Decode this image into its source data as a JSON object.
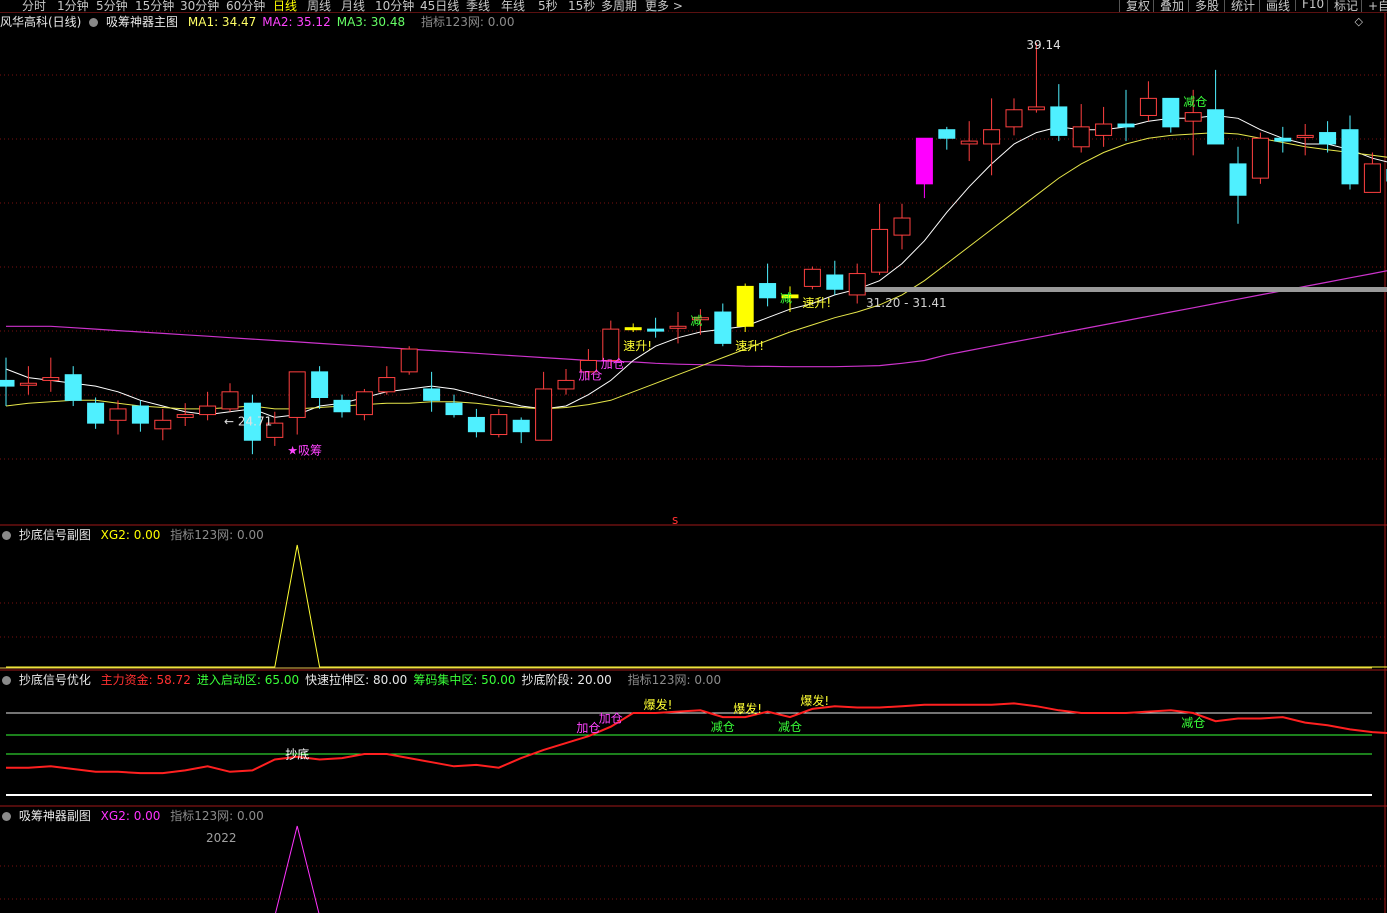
{
  "toolbar": {
    "periods": [
      "分时",
      "1分钟",
      "5分钟",
      "15分钟",
      "30分钟",
      "60分钟",
      "日线",
      "周线",
      "月线",
      "10分钟",
      "45日线",
      "季线",
      "年线",
      "5秒",
      "15秒",
      "多周期",
      "更多 >"
    ],
    "active_period": "日线",
    "tools": [
      "复权",
      "叠加",
      "多股",
      "统计",
      "画线",
      "F10",
      "标记",
      "+自"
    ]
  },
  "main_panel": {
    "title": "风华高科(日线)",
    "indicator": "吸筹神器主图",
    "ma": [
      {
        "label": "MA1:",
        "value": "34.47",
        "color": "#ffff66"
      },
      {
        "label": "MA2:",
        "value": "35.12",
        "color": "#ff44ff"
      },
      {
        "label": "MA3:",
        "value": "30.48",
        "color": "#66ff66"
      }
    ],
    "source": "指标123网: 0.00",
    "expand_icon": "diamond-icon"
  },
  "sub_panel_1": {
    "name": "抄底信号副图",
    "series": "XG2:",
    "value": "0.00",
    "source": "指标123网: 0.00"
  },
  "sub_panel_2": {
    "name": "抄底信号优化",
    "items": [
      {
        "label": "主力资金:",
        "value": "58.72",
        "color": "#ff3030"
      },
      {
        "label": "进入启动区:",
        "value": "65.00",
        "color": "#39ff39"
      },
      {
        "label": "快速拉伸区:",
        "value": "80.00",
        "color": "#e8e8e8"
      },
      {
        "label": "筹码集中区:",
        "value": "50.00",
        "color": "#39ff39"
      },
      {
        "label": "抄底阶段:",
        "value": "20.00",
        "color": "#e8e8e8"
      }
    ],
    "source": "指标123网: 0.00"
  },
  "sub_panel_3": {
    "name": "吸筹神器副图",
    "series": "XG2:",
    "value": "0.00",
    "source": "指标123网: 0.00",
    "year_label": "2022"
  },
  "chart_data": {
    "type": "candlestick",
    "main": {
      "candles": [
        {
          "o": 27.3,
          "c": 27.1,
          "h": 28.1,
          "l": 26.4
        },
        {
          "o": 27.2,
          "c": 27.2,
          "h": 27.8,
          "l": 26.8
        },
        {
          "o": 27.3,
          "c": 27.4,
          "h": 28.1,
          "l": 26.9
        },
        {
          "o": 27.5,
          "c": 26.6,
          "h": 27.8,
          "l": 26.4
        },
        {
          "o": 26.5,
          "c": 25.8,
          "h": 26.7,
          "l": 25.6
        },
        {
          "o": 25.9,
          "c": 26.3,
          "h": 26.6,
          "l": 25.4
        },
        {
          "o": 26.4,
          "c": 25.8,
          "h": 26.6,
          "l": 25.5
        },
        {
          "o": 25.6,
          "c": 25.9,
          "h": 26.3,
          "l": 25.2
        },
        {
          "o": 26.0,
          "c": 26.1,
          "h": 26.5,
          "l": 25.7
        },
        {
          "o": 26.1,
          "c": 26.4,
          "h": 26.9,
          "l": 25.9
        },
        {
          "o": 26.3,
          "c": 26.9,
          "h": 27.2,
          "l": 26.2
        },
        {
          "o": 26.5,
          "c": 25.2,
          "h": 26.8,
          "l": 24.71
        },
        {
          "o": 25.3,
          "c": 25.8,
          "h": 26.2,
          "l": 25.0
        },
        {
          "o": 26.0,
          "c": 27.6,
          "h": 27.6,
          "l": 25.4
        },
        {
          "o": 27.6,
          "c": 26.7,
          "h": 27.8,
          "l": 26.3
        },
        {
          "o": 26.6,
          "c": 26.2,
          "h": 26.8,
          "l": 26.0
        },
        {
          "o": 26.1,
          "c": 26.9,
          "h": 27.0,
          "l": 25.9
        },
        {
          "o": 26.9,
          "c": 27.4,
          "h": 27.8,
          "l": 26.8
        },
        {
          "o": 27.6,
          "c": 28.4,
          "h": 28.5,
          "l": 27.5
        },
        {
          "o": 27.0,
          "c": 26.6,
          "h": 27.6,
          "l": 26.2
        },
        {
          "o": 26.5,
          "c": 26.1,
          "h": 26.8,
          "l": 26.0
        },
        {
          "o": 26.0,
          "c": 25.5,
          "h": 26.3,
          "l": 25.3
        },
        {
          "o": 25.4,
          "c": 26.1,
          "h": 26.3,
          "l": 25.3
        },
        {
          "o": 25.9,
          "c": 25.5,
          "h": 26.0,
          "l": 25.1
        },
        {
          "o": 25.2,
          "c": 27.0,
          "h": 27.6,
          "l": 25.2
        },
        {
          "o": 27.0,
          "c": 27.3,
          "h": 27.7,
          "l": 26.8
        },
        {
          "o": 27.6,
          "c": 28.0,
          "h": 28.4,
          "l": 27.4
        },
        {
          "o": 28.0,
          "c": 29.1,
          "h": 29.4,
          "l": 27.8
        },
        {
          "o": 29.15,
          "c": 29.15,
          "h": 29.3,
          "l": 29.0
        },
        {
          "o": 29.1,
          "c": 29.05,
          "h": 29.5,
          "l": 28.8
        },
        {
          "o": 29.2,
          "c": 29.2,
          "h": 29.7,
          "l": 28.6
        },
        {
          "o": 29.5,
          "c": 29.5,
          "h": 29.8,
          "l": 28.9
        },
        {
          "o": 29.7,
          "c": 28.6,
          "h": 30.0,
          "l": 28.5
        },
        {
          "o": 29.2,
          "c": 30.6,
          "h": 30.7,
          "l": 29.0
        },
        {
          "o": 30.7,
          "c": 30.2,
          "h": 31.4,
          "l": 29.9
        },
        {
          "o": 30.2,
          "c": 30.3,
          "h": 30.6,
          "l": 29.7
        },
        {
          "o": 30.6,
          "c": 31.2,
          "h": 31.3,
          "l": 30.5
        },
        {
          "o": 31.0,
          "c": 30.5,
          "h": 31.5,
          "l": 30.3
        },
        {
          "o": 30.3,
          "c": 31.05,
          "h": 31.4,
          "l": 30.0
        },
        {
          "o": 31.1,
          "c": 32.6,
          "h": 33.5,
          "l": 31.0
        },
        {
          "o": 32.4,
          "c": 33.0,
          "h": 33.5,
          "l": 31.9
        },
        {
          "o": 34.2,
          "c": 35.8,
          "h": 35.8,
          "l": 33.7
        },
        {
          "o": 36.1,
          "c": 35.8,
          "h": 36.2,
          "l": 35.4
        },
        {
          "o": 35.6,
          "c": 35.7,
          "h": 36.4,
          "l": 35.0
        },
        {
          "o": 35.6,
          "c": 36.1,
          "h": 37.2,
          "l": 34.5
        },
        {
          "o": 36.2,
          "c": 36.8,
          "h": 37.2,
          "l": 35.9
        },
        {
          "o": 36.8,
          "c": 36.9,
          "h": 39.14,
          "l": 36.7
        },
        {
          "o": 36.9,
          "c": 35.9,
          "h": 37.7,
          "l": 35.7
        },
        {
          "o": 35.5,
          "c": 36.2,
          "h": 37.0,
          "l": 35.3
        },
        {
          "o": 35.9,
          "c": 36.3,
          "h": 36.9,
          "l": 35.5
        },
        {
          "o": 36.3,
          "c": 36.2,
          "h": 37.5,
          "l": 35.7
        },
        {
          "o": 36.6,
          "c": 37.2,
          "h": 37.8,
          "l": 36.4
        },
        {
          "o": 37.2,
          "c": 36.2,
          "h": 37.2,
          "l": 36.0
        },
        {
          "o": 36.4,
          "c": 36.7,
          "h": 37.5,
          "l": 35.2
        },
        {
          "o": 36.8,
          "c": 35.6,
          "h": 38.2,
          "l": 35.6
        },
        {
          "o": 34.9,
          "c": 33.8,
          "h": 35.5,
          "l": 32.8
        },
        {
          "o": 34.4,
          "c": 35.8,
          "h": 36.0,
          "l": 34.2
        },
        {
          "o": 35.8,
          "c": 35.7,
          "h": 36.2,
          "l": 35.3
        },
        {
          "o": 35.9,
          "c": 35.9,
          "h": 36.3,
          "l": 35.2
        },
        {
          "o": 36.0,
          "c": 35.6,
          "h": 36.4,
          "l": 35.3
        },
        {
          "o": 36.1,
          "c": 34.2,
          "h": 36.6,
          "l": 34.0
        },
        {
          "o": 33.9,
          "c": 34.9,
          "h": 35.3,
          "l": 33.9
        },
        {
          "o": 34.7,
          "c": 34.3,
          "h": 34.8,
          "l": 34.0
        },
        {
          "o": 34.2,
          "c": 34.4,
          "h": 34.8,
          "l": 33.9
        },
        {
          "o": 34.4,
          "c": 33.6,
          "h": 34.5,
          "l": 32.7
        }
      ],
      "ma1": [
        27.7,
        27.4,
        27.3,
        27.2,
        27.1,
        26.9,
        26.6,
        26.4,
        26.2,
        26.1,
        26.2,
        26.3,
        26.0,
        26.1,
        26.4,
        26.5,
        26.7,
        26.9,
        27.0,
        27.1,
        27.0,
        26.8,
        26.6,
        26.4,
        26.3,
        26.4,
        26.8,
        27.3,
        28.0,
        28.5,
        28.8,
        29.0,
        29.1,
        29.2,
        29.5,
        29.8,
        30.0,
        30.3,
        30.5,
        30.8,
        31.4,
        32.2,
        33.2,
        34.1,
        34.9,
        35.6,
        36.0,
        36.2,
        36.1,
        36.1,
        36.2,
        36.4,
        36.5,
        36.5,
        36.6,
        36.5,
        36.1,
        35.8,
        35.6,
        35.6,
        35.4,
        35.1,
        34.9,
        34.6,
        34.3
      ],
      "ma2": [
        29.2,
        29.2,
        29.2,
        29.15,
        29.1,
        29.05,
        29.0,
        28.95,
        28.9,
        28.85,
        28.8,
        28.75,
        28.7,
        28.65,
        28.6,
        28.55,
        28.5,
        28.45,
        28.4,
        28.35,
        28.3,
        28.25,
        28.2,
        28.15,
        28.1,
        28.05,
        28.0,
        27.97,
        27.95,
        27.9,
        27.87,
        27.85,
        27.83,
        27.8,
        27.79,
        27.78,
        27.78,
        27.78,
        27.8,
        27.82,
        27.9,
        28.0,
        28.2,
        28.35,
        28.5,
        28.65,
        28.8,
        28.95,
        29.1,
        29.25,
        29.4,
        29.55,
        29.7,
        29.85,
        30.0,
        30.15,
        30.3,
        30.45,
        30.6,
        30.75,
        30.9,
        31.05,
        31.2,
        31.35,
        31.5
      ],
      "ma3": [
        26.4,
        26.5,
        26.55,
        26.6,
        26.6,
        26.5,
        26.4,
        26.35,
        26.3,
        26.3,
        26.35,
        26.4,
        26.3,
        26.3,
        26.35,
        26.4,
        26.45,
        26.5,
        26.5,
        26.55,
        26.55,
        26.5,
        26.4,
        26.35,
        26.3,
        26.35,
        26.45,
        26.6,
        26.9,
        27.2,
        27.5,
        27.8,
        28.1,
        28.4,
        28.7,
        29.0,
        29.25,
        29.5,
        29.7,
        29.95,
        30.3,
        30.8,
        31.4,
        32.0,
        32.6,
        33.2,
        33.8,
        34.4,
        34.9,
        35.3,
        35.6,
        35.8,
        35.9,
        35.95,
        36.0,
        35.95,
        35.8,
        35.65,
        35.5,
        35.4,
        35.3,
        35.2,
        35.1,
        34.9,
        34.6
      ],
      "annotations": [
        {
          "i": 10,
          "text": "← 24.71",
          "type": "low"
        },
        {
          "i": 13,
          "text": "★吸筹",
          "type": "tag_magenta"
        },
        {
          "i": 26,
          "text": "加仓",
          "type": "tag_magenta"
        },
        {
          "i": 27,
          "text": "加仓",
          "type": "tag_magenta"
        },
        {
          "i": 28,
          "text": "速升!",
          "type": "tag_yellow"
        },
        {
          "i": 31,
          "text": "减",
          "type": "tag_green"
        },
        {
          "i": 33,
          "text": "速升!",
          "type": "tag_yellow"
        },
        {
          "i": 35,
          "text": "减",
          "type": "tag_green"
        },
        {
          "i": 36,
          "text": "速升!",
          "type": "tag_yellow"
        },
        {
          "i": 46,
          "text": "39.14",
          "type": "high"
        },
        {
          "i": 53,
          "text": "减仓",
          "type": "tag_green"
        }
      ],
      "support_label": "31.20 - 31.41",
      "marker": "s"
    },
    "sub1": {
      "peak_index": 13,
      "peak_value": 1
    },
    "sub2": {
      "series": [
        40,
        40,
        41,
        39,
        37,
        37,
        36,
        36,
        38,
        41,
        37,
        38,
        46,
        48,
        46,
        47,
        50,
        50,
        47,
        44,
        41,
        42,
        40,
        47,
        53,
        58,
        63,
        70,
        80,
        80,
        81,
        82,
        77,
        77,
        81,
        77,
        83,
        85,
        84,
        84,
        85,
        86,
        86,
        86,
        86,
        87,
        85,
        82,
        80,
        80,
        80,
        81,
        82,
        80,
        74,
        76,
        76,
        77,
        73,
        71,
        68,
        66,
        65,
        62,
        60
      ],
      "lines": [
        {
          "value": 80,
          "color": "#e8e8e8",
          "label": "快速拉伸区"
        },
        {
          "value": 65,
          "color": "#39ff39",
          "label": "进入启动区"
        },
        {
          "value": 50,
          "color": "#39ff39",
          "label": "筹码集中区"
        },
        {
          "value": 20,
          "color": "#ffffff",
          "label": "抄底阶段"
        }
      ],
      "annotations": [
        {
          "i": 13,
          "text": "抄底",
          "color": "#ffffff"
        },
        {
          "i": 26,
          "text": "加仓",
          "color": "#ff44ff"
        },
        {
          "i": 27,
          "text": "加仓",
          "color": "#ff44ff"
        },
        {
          "i": 29,
          "text": "爆发!",
          "color": "#ffff33"
        },
        {
          "i": 32,
          "text": "减仓",
          "color": "#39ff39"
        },
        {
          "i": 33,
          "text": "爆发!",
          "color": "#ffff33"
        },
        {
          "i": 35,
          "text": "减仓",
          "color": "#39ff39"
        },
        {
          "i": 36,
          "text": "爆发!",
          "color": "#ffff33"
        },
        {
          "i": 53,
          "text": "减仓",
          "color": "#39ff39"
        }
      ]
    },
    "sub3": {
      "peak_index": 13,
      "peak_value": 1
    }
  }
}
